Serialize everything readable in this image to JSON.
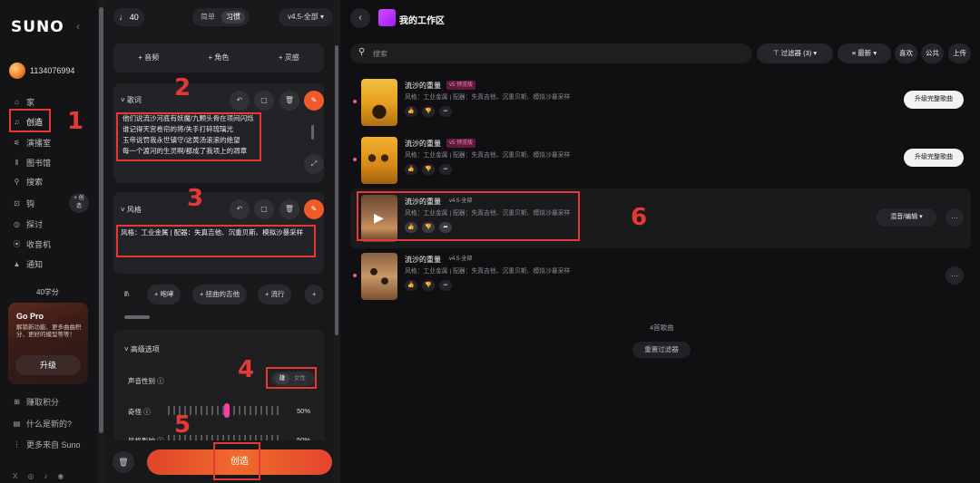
{
  "sidebar": {
    "logo": "SUNO",
    "collapse": "‹",
    "username": "1134076994",
    "nav": [
      {
        "label": "家",
        "icon": "⌂"
      },
      {
        "label": "创造",
        "icon": "♫"
      },
      {
        "label": "演播室",
        "icon": "⚟"
      },
      {
        "label": "图书馆",
        "icon": "⦀"
      },
      {
        "label": "搜索",
        "icon": "⚲"
      },
      {
        "label": "钩",
        "icon": "⊡"
      },
      {
        "label": "探讨",
        "icon": "◎"
      },
      {
        "label": "收音机",
        "icon": "⦿"
      },
      {
        "label": "通知",
        "icon": "▲"
      }
    ],
    "create_pill": "+ 创\n造",
    "credits": "40学分",
    "gopro": {
      "title": "Go Pro",
      "text": "解锁新功能、更多曲曲积分、更好的模型等等！",
      "button": "升级"
    },
    "bottom": [
      {
        "label": "赚取积分",
        "icon": "⊞"
      },
      {
        "label": "什么是新的?",
        "icon": "▤"
      },
      {
        "label": "更多来自 Suno",
        "icon": "⋮"
      }
    ],
    "socials": [
      "X",
      "◎",
      "♪",
      "◉"
    ]
  },
  "create": {
    "credit_count": "♩ 40",
    "mode_simple": "简单",
    "mode_custom": "习惯",
    "version": "v4.5-全部 ▾",
    "top_adds": [
      "+ 音频",
      "+ 角色",
      "+ 灵感"
    ],
    "lyrics": {
      "title": "˅  歌词",
      "text": "他们说流沙河底有妖魔/九颗头骨在项间闪烁\n谁记得天宫卷帘的将/失手打碎琉璃光\n玉帝说罚我永世镇守/这黄汤滚滚的绝望\n每一个渡河的生灵啊/都成了我项上的凋章"
    },
    "style": {
      "title": "˅  风格",
      "text": "风格：工业金属 | 配器：失真吉他、沉重贝斯、模拟沙暴采样"
    },
    "chips": [
      "⦀\\",
      "+ 咆哮",
      "+ 扭曲的吉他",
      "+ 流行",
      "+"
    ],
    "advanced": {
      "title": "˅  高级选项",
      "voice_gender_label": "声音性别 ⓘ",
      "gender_male": "雄",
      "gender_female": "女性",
      "weird_label": "奇怪 ⓘ",
      "weird_value": "50%",
      "weird_level": 0.5,
      "style_influence_label": "风格影响 ⓘ",
      "style_influence_value": "50%"
    },
    "create_button": "创造"
  },
  "workspace": {
    "title": "我的工作区",
    "search_placeholder": "搜索",
    "filter": "⊤  过滤器 (3)  ▾",
    "sort": "≡  最新  ▾",
    "liked": "喜欢",
    "public": "公共",
    "upload": "上传",
    "songs": [
      {
        "title": "流沙的重量",
        "version": "v5 预览版",
        "style": "风格：工业金属 | 配器：失真吉他、沉重贝斯、模拟沙暴采样",
        "action": "升级完整歌曲",
        "unread": true
      },
      {
        "title": "流沙的重量",
        "version": "v5 预览版",
        "style": "风格：工业金属 | 配器：失真吉他、沉重贝斯、模拟沙暴采样",
        "action": "升级完整歌曲",
        "unread": true
      },
      {
        "title": "流沙的重量",
        "version": "v4.5-全部",
        "style": "风格：工业金属 | 配器：失真吉他、沉重贝斯、模拟沙暴采样",
        "action": "混音/编辑  ▾",
        "unread": false
      },
      {
        "title": "流沙的重量",
        "version": "v4.5-全部",
        "style": "风格：工业金属 | 配器：失真吉他、沉重贝斯、模拟沙暴采样",
        "action": "",
        "unread": true
      }
    ],
    "song_count": "4首歌曲",
    "reset_filter": "重置过滤器"
  },
  "annotations": [
    "1",
    "2",
    "3",
    "4",
    "5",
    "6"
  ],
  "colors": {
    "accent": "#f05a28",
    "annotation": "#e53935",
    "pink": "#ff3ea5"
  }
}
